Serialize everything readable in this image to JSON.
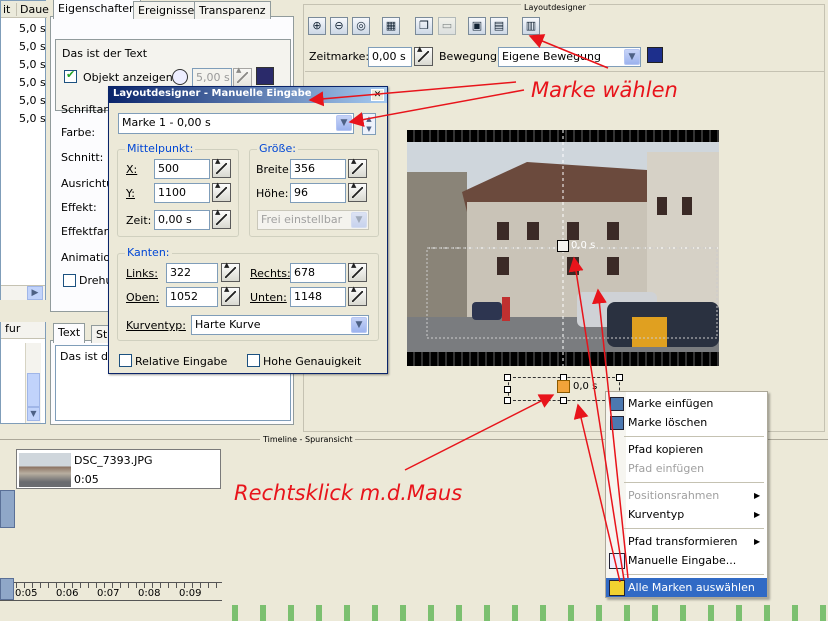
{
  "left_list": {
    "headers": [
      "it",
      "Daue"
    ],
    "rows": [
      "5,0 s",
      "5,0 s",
      "5,0 s",
      "5,0 s",
      "5,0 s",
      "5,0 s"
    ],
    "partial_label": "fur"
  },
  "properties": {
    "tabs": [
      "Eigenschaften",
      "Ereignisse",
      "Transparenz"
    ],
    "text_value": "Das ist der Text",
    "show_object_label": "Objekt anzeigen",
    "show_object_duration": "5,00 s",
    "labels": [
      "Schriftart",
      "Farbe:",
      "Schnitt:",
      "Ausrichtu",
      "Effekt:",
      "Effektfarb",
      "Animation",
      "Drehu"
    ]
  },
  "text_panel": {
    "tabs": [
      "Text",
      "St"
    ],
    "content": "Das ist de"
  },
  "layoutdesigner": {
    "title": "Layoutdesigner",
    "zeitmarke_label": "Zeitmarke:",
    "zeitmarke_value": "0,00 s",
    "bewegung_label": "Bewegung:",
    "bewegung_value": "Eigene Bewegung",
    "marker_text": "0,0 s",
    "marker_text_bottom": "0,0 s"
  },
  "dialog": {
    "title": "Layoutdesigner - Manuelle Eingabe",
    "marke_select": "Marke 1 - 0,00 s",
    "mittelpunkt": {
      "title": "Mittelpunkt:",
      "x_label": "X:",
      "x_value": "500",
      "y_label": "Y:",
      "y_value": "1100",
      "zeit_label": "Zeit:",
      "zeit_value": "0,00 s"
    },
    "groesse": {
      "title": "Größe:",
      "breite_label": "Breite:",
      "breite_value": "356",
      "hoehe_label": "Höhe:",
      "hoehe_value": "96",
      "frei_value": "Frei einstellbar"
    },
    "kanten": {
      "title": "Kanten:",
      "links_label": "Links:",
      "links_value": "322",
      "rechts_label": "Rechts:",
      "rechts_value": "678",
      "oben_label": "Oben:",
      "oben_value": "1052",
      "unten_label": "Unten:",
      "unten_value": "1148",
      "kurventyp_label": "Kurventyp:",
      "kurventyp_value": "Harte Kurve"
    },
    "relative_label": "Relative Eingabe",
    "hohe_label": "Hohe Genauigkeit"
  },
  "context_menu": {
    "items": [
      {
        "label": "Marke einfügen",
        "disabled": false,
        "icon": true
      },
      {
        "label": "Marke löschen",
        "disabled": false,
        "icon": true
      },
      {
        "label": "Pfad kopieren",
        "disabled": false
      },
      {
        "label": "Pfad einfügen",
        "disabled": true
      },
      {
        "label": "Positionsrahmen",
        "disabled": true,
        "submenu": true
      },
      {
        "label": "Kurventyp",
        "disabled": false,
        "submenu": true
      },
      {
        "label": "Pfad transformieren",
        "disabled": false,
        "submenu": true
      },
      {
        "label": "Manuelle Eingabe...",
        "disabled": false,
        "icon": true
      },
      {
        "label": "Alle Marken auswählen",
        "disabled": false,
        "icon": true,
        "highlighted": true
      }
    ]
  },
  "timeline": {
    "title": "Timeline - Spuransicht",
    "clip_name": "DSC_7393.JPG",
    "clip_duration": "0:05",
    "ruler": [
      "0:05",
      "0:06",
      "0:07",
      "0:08",
      "0:09"
    ]
  },
  "annotations": {
    "marke": "Marke wählen",
    "rechtsklick": "Rechtsklick m.d.Maus"
  },
  "colors": {
    "annotation": "#e8141b",
    "dialog_title": "#0a246a",
    "menu_highlight": "#316ac5"
  }
}
